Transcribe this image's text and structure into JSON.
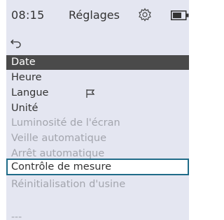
{
  "status_bar": {
    "time": "08:15",
    "title": "Réglages",
    "gear_icon": "gear-icon",
    "battery_icon": "battery-icon"
  },
  "menu": {
    "back_icon": "back-arrow-icon",
    "items": [
      {
        "label": "Date",
        "state": "selected"
      },
      {
        "label": "Heure",
        "state": "normal"
      },
      {
        "label": "Langue",
        "state": "normal",
        "icon": "flag-icon"
      },
      {
        "label": "Unité",
        "state": "normal"
      },
      {
        "label": "Luminosité de l'écran",
        "state": "disabled"
      },
      {
        "label": "Veille automatique",
        "state": "disabled"
      },
      {
        "label": "Arrêt automatique",
        "state": "disabled"
      },
      {
        "label": "Contrôle de mesure",
        "state": "focused"
      },
      {
        "label": "Réinitialisation d'usine",
        "state": "disabled"
      }
    ],
    "more_indicator": "---"
  },
  "colors": {
    "background": "#e4e6f1",
    "selected_bg": "#4a4a4a",
    "focus_border": "#1f6b88",
    "disabled_text": "#a3a5ad",
    "text": "#333333"
  }
}
